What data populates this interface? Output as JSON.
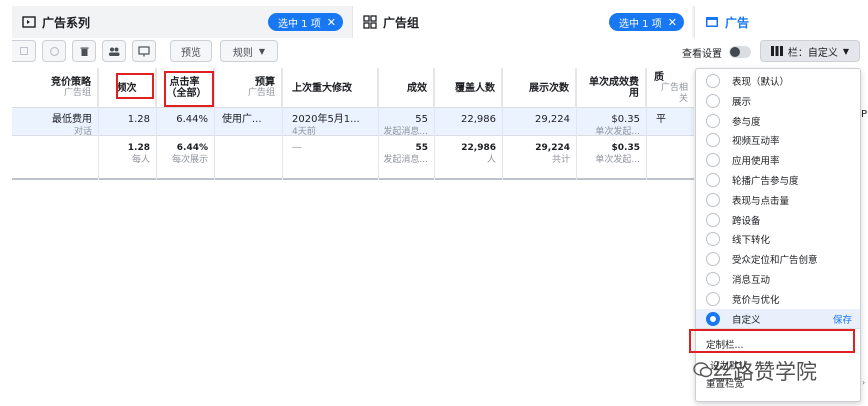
{
  "tabs": {
    "campaign": {
      "label": "广告系列",
      "pill": "选中 1 项"
    },
    "adset": {
      "label": "广告组",
      "pill": "选中 1 项"
    },
    "ad": {
      "label": "广告"
    }
  },
  "toolbar": {
    "preview": "预览",
    "rules": "规则",
    "view_settings": "查看设置",
    "columns": "栏：自定义"
  },
  "table": {
    "headers": [
      {
        "label": "竞价策略",
        "sub": "广告组"
      },
      {
        "label": "频次",
        "sub": ""
      },
      {
        "label": "点击率（全部）",
        "sub": ""
      },
      {
        "label": "预算",
        "sub": "广告组"
      },
      {
        "label": "上次重大修改",
        "sub": ""
      },
      {
        "label": "成效",
        "sub": ""
      },
      {
        "label": "覆盖人数",
        "sub": ""
      },
      {
        "label": "展示次数",
        "sub": ""
      },
      {
        "label": "单次成效费用",
        "sub": ""
      },
      {
        "label": "质",
        "sub": "广告相关"
      }
    ],
    "row": {
      "bid": {
        "main": "最低费用",
        "sub": "对话"
      },
      "freq": "1.28",
      "ctr": "6.44%",
      "budget": "使用广...",
      "last_edit": {
        "main": "2020年5月1...",
        "sub": "4天前"
      },
      "results": {
        "main": "55",
        "sub": "发起消息..."
      },
      "reach": "22,986",
      "impr": "29,224",
      "cpr": {
        "main": "$0.35",
        "sub": "单次发起..."
      },
      "quality": "平"
    },
    "total": {
      "freq": {
        "main": "1.28",
        "sub": "每人"
      },
      "ctr": {
        "main": "6.44%",
        "sub": "每次展示"
      },
      "last_edit": "—",
      "results": {
        "main": "55",
        "sub": "发起消息..."
      },
      "reach": {
        "main": "22,986",
        "sub": "人"
      },
      "impr": {
        "main": "29,224",
        "sub": "共计"
      },
      "cpr": {
        "main": "$0.35",
        "sub": "单次发起..."
      }
    }
  },
  "dropdown": {
    "options": [
      {
        "label": "表现（默认）",
        "selected": false
      },
      {
        "label": "展示",
        "selected": false
      },
      {
        "label": "参与度",
        "selected": false
      },
      {
        "label": "视频互动率",
        "selected": false
      },
      {
        "label": "应用使用率",
        "selected": false
      },
      {
        "label": "轮播广告参与度",
        "selected": false
      },
      {
        "label": "表现与点击量",
        "selected": false
      },
      {
        "label": "跨设备",
        "selected": false
      },
      {
        "label": "线下转化",
        "selected": false
      },
      {
        "label": "受众定位和广告创意",
        "selected": false
      },
      {
        "label": "消息互动",
        "selected": false
      },
      {
        "label": "竞价与优化",
        "selected": false
      },
      {
        "label": "自定义",
        "selected": true,
        "action": "保存"
      }
    ],
    "customize": "定制栏...",
    "set_default": "设为默认",
    "reset": "重置栏宽"
  },
  "watermark": "丝路赞学院",
  "colors": {
    "accent": "#1877f2",
    "highlight": "#e02020",
    "selected_row": "#eaf3ff"
  }
}
